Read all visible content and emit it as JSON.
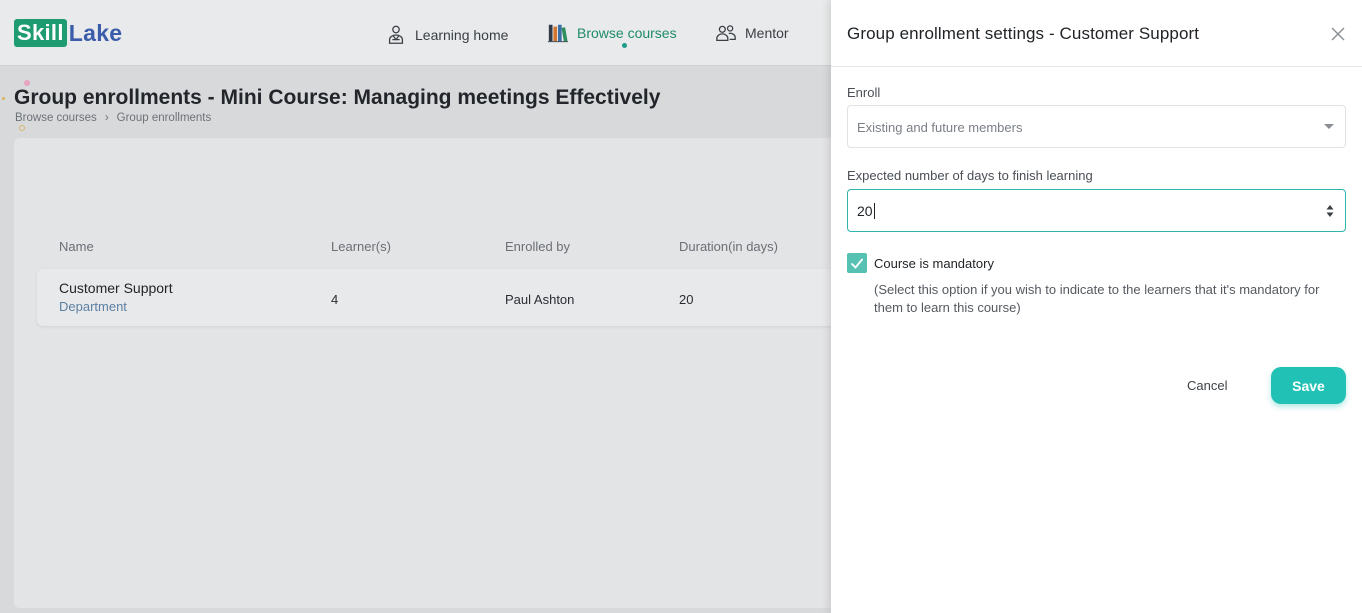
{
  "app": {
    "logo_part1": "Skill",
    "logo_part2": "Lake",
    "brand_color": "#1e9b70",
    "accent_color": "#22c1b5"
  },
  "nav": {
    "items": [
      {
        "label": "Learning home",
        "icon": "learner-icon"
      },
      {
        "label": "Browse courses",
        "icon": "books-icon",
        "active": true
      },
      {
        "label": "Mentor",
        "icon": "users-icon"
      }
    ]
  },
  "page": {
    "title": "Group enrollments - Mini Course: Managing meetings Effectively",
    "breadcrumb": [
      "Browse courses",
      "Group enrollments"
    ],
    "breadcrumb_separator": "›"
  },
  "table": {
    "headers": [
      "Name",
      "Learner(s)",
      "Enrolled by",
      "Duration(in days)"
    ],
    "rows": [
      {
        "name": "Customer Support",
        "type": "Department",
        "learners": "4",
        "enrolled_by": "Paul Ashton",
        "duration": "20"
      }
    ]
  },
  "drawer": {
    "title": "Group enrollment settings - Customer Support",
    "enroll_label": "Enroll",
    "enroll_value": "Existing and future members",
    "days_label": "Expected number of days to finish learning",
    "days_value": "20",
    "mandatory_checked": true,
    "mandatory_label": "Course is mandatory",
    "mandatory_help": "(Select this option if you wish to indicate to the learners that it's mandatory for them to learn this course)",
    "cancel_label": "Cancel",
    "save_label": "Save"
  }
}
